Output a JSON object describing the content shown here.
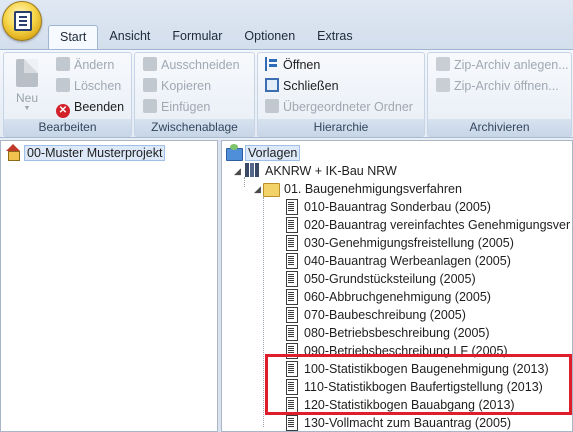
{
  "ribbon": {
    "tabs": [
      "Start",
      "Ansicht",
      "Formular",
      "Optionen",
      "Extras"
    ],
    "groups": {
      "bearbeiten": {
        "label": "Bearbeiten",
        "new_label": "Neu",
        "aendern": "Ändern",
        "loeschen": "Löschen",
        "beenden": "Beenden"
      },
      "zwischenablage": {
        "label": "Zwischenablage",
        "ausschneiden": "Ausschneiden",
        "kopieren": "Kopieren",
        "einfuegen": "Einfügen"
      },
      "hierarchie": {
        "label": "Hierarchie",
        "oeffnen": "Öffnen",
        "schliessen": "Schließen",
        "uebergeordneter": "Übergeordneter Ordner"
      },
      "archivieren": {
        "label": "Archivieren",
        "zip_anlegen": "Zip-Archiv anlegen...",
        "zip_oeffnen": "Zip-Archiv öffnen..."
      }
    }
  },
  "left_pane": {
    "project": "00-Muster Musterprojekt"
  },
  "right_pane": {
    "root": "Vorlagen",
    "library": "AKNRW + IK-Bau NRW",
    "folder": "01. Baugenehmigungsverfahren",
    "documents": [
      "010-Bauantrag Sonderbau (2005)",
      "020-Bauantrag vereinfachtes Genehmigungsver",
      "030-Genehmigungsfreistellung (2005)",
      "040-Bauantrag Werbeanlagen (2005)",
      "050-Grundstücksteilung (2005)",
      "060-Abbruchgenehmigung (2005)",
      "070-Baubeschreibung (2005)",
      "080-Betriebsbeschreibung (2005)",
      "090-Betriebsbeschreibung LF (2005)",
      "100-Statistikbogen Baugenehmigung (2013)",
      "110-Statistikbogen Baufertigstellung (2013)",
      "120-Statistikbogen Bauabgang (2013)",
      "130-Vollmacht zum Bauantrag (2005)"
    ]
  },
  "colors": {
    "highlight": "#e01e2b",
    "ribbon_bg": "#dfe8f3",
    "selection": "#dde9f8"
  }
}
